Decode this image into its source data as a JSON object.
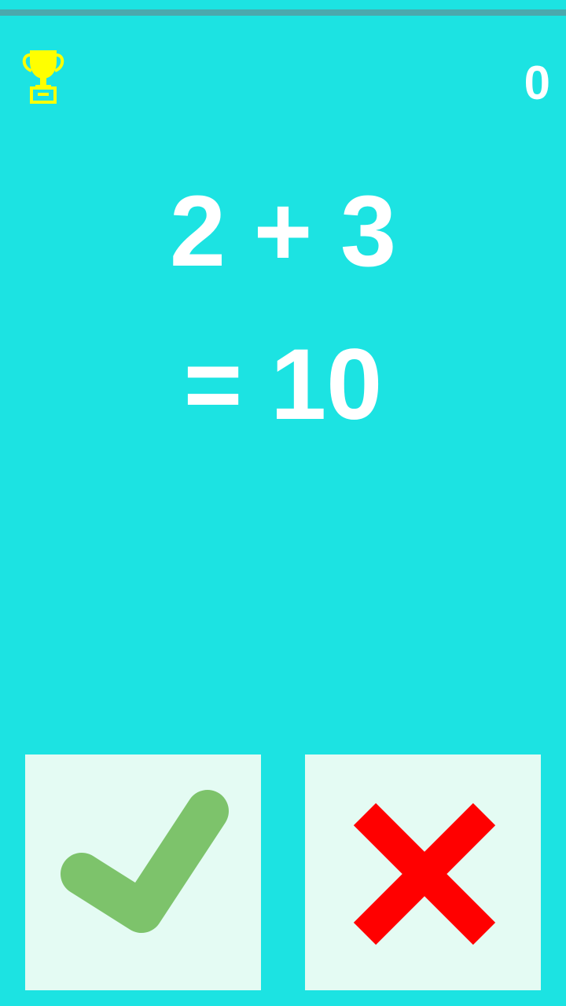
{
  "header": {
    "trophy_icon": "trophy-icon",
    "score": "0"
  },
  "equation": {
    "question": "2 + 3",
    "answer": "= 10"
  },
  "buttons": {
    "correct_icon": "checkmark-icon",
    "wrong_icon": "cross-icon"
  },
  "colors": {
    "background": "#1ce3e2",
    "top_strip": "#4aa9ad",
    "trophy": "#ffff00",
    "button_bg": "#e4fbf3",
    "check": "#7dc36b",
    "cross": "#ff0000"
  }
}
